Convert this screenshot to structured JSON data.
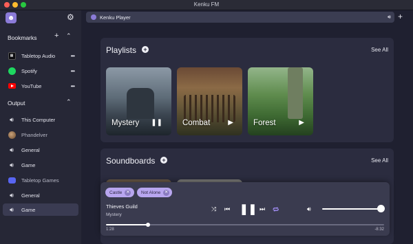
{
  "window": {
    "title": "Kenku FM"
  },
  "sidebar": {
    "bookmarks_heading": "Bookmarks",
    "bookmarks": [
      {
        "label": "Tabletop Audio",
        "icon": "tabletop-audio-icon"
      },
      {
        "label": "Spotify",
        "icon": "spotify-icon"
      },
      {
        "label": "YouTube",
        "icon": "youtube-icon"
      }
    ],
    "output_heading": "Output",
    "outputs": [
      {
        "label": "This Computer",
        "icon": "speaker-icon"
      },
      {
        "label": "Phandelver",
        "icon": "server-avatar-icon"
      },
      {
        "label": "General",
        "icon": "speaker-icon"
      },
      {
        "label": "Game",
        "icon": "speaker-icon"
      },
      {
        "label": "Tabletop Games",
        "icon": "discord-icon"
      },
      {
        "label": "General",
        "icon": "speaker-icon"
      },
      {
        "label": "Game",
        "icon": "speaker-icon",
        "active": true
      }
    ]
  },
  "topbar": {
    "tab_label": "Kenku Player"
  },
  "playlists": {
    "heading": "Playlists",
    "see_all": "See All",
    "items": [
      {
        "name": "Mystery",
        "state": "playing"
      },
      {
        "name": "Combat",
        "state": "paused"
      },
      {
        "name": "Forest",
        "state": "paused"
      }
    ]
  },
  "soundboards": {
    "heading": "Soundboards",
    "see_all": "See All"
  },
  "player": {
    "chips": [
      {
        "label": "Castle"
      },
      {
        "label": "Not Alone"
      }
    ],
    "track_title": "Thieves Guild",
    "track_playlist": "Mystery",
    "elapsed": "1:28",
    "remaining": "-8:32",
    "progress": 0.15,
    "volume": 1.0,
    "repeat_active": true
  },
  "colors": {
    "accent": "#9f8bf0",
    "chip": "#b8a6ef",
    "panel": "#2b2c3f",
    "sidebar": "#262736"
  }
}
